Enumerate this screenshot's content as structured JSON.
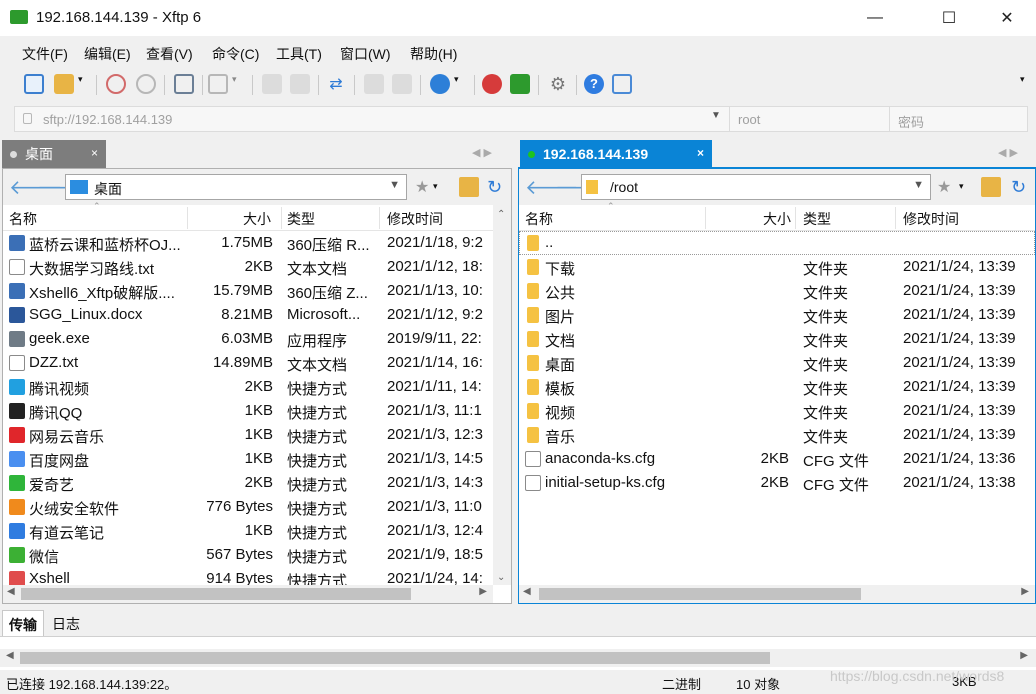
{
  "window": {
    "title": "192.168.144.139   - Xftp 6"
  },
  "window_controls": {
    "minimize": "—",
    "maximize": "☐",
    "close": "✕"
  },
  "menu": [
    "文件(F)",
    "编辑(E)",
    "查看(V)",
    "命令(C)",
    "工具(T)",
    "窗口(W)",
    "帮助(H)"
  ],
  "address_bar": {
    "url": "sftp://192.168.144.139",
    "username_placeholder": "root",
    "password_placeholder": "密码"
  },
  "left_tab": {
    "label": "桌面",
    "close": "×"
  },
  "right_tab": {
    "label": "192.168.144.139",
    "close": "×"
  },
  "left_pane": {
    "path": "桌面",
    "columns": [
      "名称",
      "大小",
      "类型",
      "修改时间"
    ],
    "rows": [
      {
        "name": "蓝桥云课和蓝桥杯OJ...",
        "size": "1.75MB",
        "type": "360压缩 R...",
        "modified": "2021/1/18, 9:2",
        "icon": "archive-icon",
        "color": "#3b6fb6"
      },
      {
        "name": "大数据学习路线.txt",
        "size": "2KB",
        "type": "文本文档",
        "modified": "2021/1/12, 18:",
        "icon": "text-file-icon",
        "color": "#ffffff"
      },
      {
        "name": "Xshell6_Xftp破解版....",
        "size": "15.79MB",
        "type": "360压缩 Z...",
        "modified": "2021/1/13, 10:",
        "icon": "archive-icon",
        "color": "#3b6fb6"
      },
      {
        "name": "SGG_Linux.docx",
        "size": "8.21MB",
        "type": "Microsoft...",
        "modified": "2021/1/12, 9:2",
        "icon": "word-icon",
        "color": "#2b579a"
      },
      {
        "name": "geek.exe",
        "size": "6.03MB",
        "type": "应用程序",
        "modified": "2019/9/11, 22:",
        "icon": "exe-icon",
        "color": "#6f7b86"
      },
      {
        "name": "DZZ.txt",
        "size": "14.89MB",
        "type": "文本文档",
        "modified": "2021/1/14, 16:",
        "icon": "text-file-icon",
        "color": "#ffffff"
      },
      {
        "name": "腾讯视频",
        "size": "2KB",
        "type": "快捷方式",
        "modified": "2021/1/11, 14:",
        "icon": "tencent-video-icon",
        "color": "#21a0e0"
      },
      {
        "name": "腾讯QQ",
        "size": "1KB",
        "type": "快捷方式",
        "modified": "2021/1/3, 11:1",
        "icon": "qq-icon",
        "color": "#222222"
      },
      {
        "name": "网易云音乐",
        "size": "1KB",
        "type": "快捷方式",
        "modified": "2021/1/3, 12:3",
        "icon": "netease-music-icon",
        "color": "#e0262b"
      },
      {
        "name": "百度网盘",
        "size": "1KB",
        "type": "快捷方式",
        "modified": "2021/1/3, 14:5",
        "icon": "baidu-netdisk-icon",
        "color": "#4a8ff0"
      },
      {
        "name": "爱奇艺",
        "size": "2KB",
        "type": "快捷方式",
        "modified": "2021/1/3, 14:3",
        "icon": "iqiyi-icon",
        "color": "#2fb53a"
      },
      {
        "name": "火绒安全软件",
        "size": "776 Bytes",
        "type": "快捷方式",
        "modified": "2021/1/3, 11:0",
        "icon": "huorong-icon",
        "color": "#f08a1c"
      },
      {
        "name": "有道云笔记",
        "size": "1KB",
        "type": "快捷方式",
        "modified": "2021/1/3, 12:4",
        "icon": "youdao-note-icon",
        "color": "#2f7ce0"
      },
      {
        "name": "微信",
        "size": "567 Bytes",
        "type": "快捷方式",
        "modified": "2021/1/9, 18:5",
        "icon": "wechat-icon",
        "color": "#3cb034"
      },
      {
        "name": "Xshell",
        "size": "914 Bytes",
        "type": "快捷方式",
        "modified": "2021/1/24, 14:",
        "icon": "xshell-icon",
        "color": "#e04c4c"
      }
    ]
  },
  "right_pane": {
    "path": "/root",
    "columns": [
      "名称",
      "大小",
      "类型",
      "修改时间"
    ],
    "rows": [
      {
        "name": "..",
        "size": "",
        "type": "",
        "modified": "",
        "icon": "folder-icon",
        "color": "#f5c242"
      },
      {
        "name": "下载",
        "size": "",
        "type": "文件夹",
        "modified": "2021/1/24, 13:39",
        "icon": "folder-icon",
        "color": "#f5c242"
      },
      {
        "name": "公共",
        "size": "",
        "type": "文件夹",
        "modified": "2021/1/24, 13:39",
        "icon": "folder-icon",
        "color": "#f5c242"
      },
      {
        "name": "图片",
        "size": "",
        "type": "文件夹",
        "modified": "2021/1/24, 13:39",
        "icon": "folder-icon",
        "color": "#f5c242"
      },
      {
        "name": "文档",
        "size": "",
        "type": "文件夹",
        "modified": "2021/1/24, 13:39",
        "icon": "folder-icon",
        "color": "#f5c242"
      },
      {
        "name": "桌面",
        "size": "",
        "type": "文件夹",
        "modified": "2021/1/24, 13:39",
        "icon": "folder-icon",
        "color": "#f5c242"
      },
      {
        "name": "模板",
        "size": "",
        "type": "文件夹",
        "modified": "2021/1/24, 13:39",
        "icon": "folder-icon",
        "color": "#f5c242"
      },
      {
        "name": "视频",
        "size": "",
        "type": "文件夹",
        "modified": "2021/1/24, 13:39",
        "icon": "folder-icon",
        "color": "#f5c242"
      },
      {
        "name": "音乐",
        "size": "",
        "type": "文件夹",
        "modified": "2021/1/24, 13:39",
        "icon": "folder-icon",
        "color": "#f5c242"
      },
      {
        "name": "anaconda-ks.cfg",
        "size": "2KB",
        "type": "CFG 文件",
        "modified": "2021/1/24, 13:36",
        "icon": "file-icon",
        "color": "#ffffff"
      },
      {
        "name": "initial-setup-ks.cfg",
        "size": "2KB",
        "type": "CFG 文件",
        "modified": "2021/1/24, 13:38",
        "icon": "file-icon",
        "color": "#ffffff"
      }
    ]
  },
  "bottom_tabs": [
    "传输",
    "日志"
  ],
  "status": {
    "connection": "已连接 192.168.144.139:22。",
    "mode": "二进制",
    "count": "10 对象",
    "size": "3KB"
  },
  "watermark": "https://blog.csdn.net/words8",
  "colors": {
    "accent": "#0a84d6",
    "active_tab": "#0a84d6",
    "connected_dot": "#1ec41e",
    "inactive_tab": "#7d7d7d"
  }
}
